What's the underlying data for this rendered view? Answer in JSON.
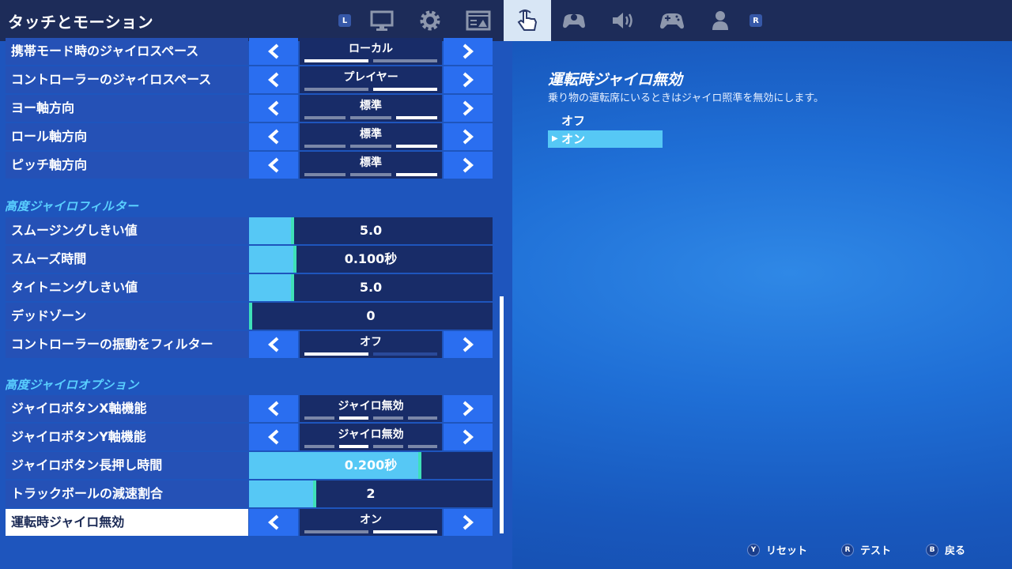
{
  "header": {
    "title": "タッチとモーション",
    "shoulder_left": "L",
    "shoulder_right": "R",
    "tabs": [
      {
        "icon": "monitor-icon"
      },
      {
        "icon": "gear-icon"
      },
      {
        "icon": "display-settings-icon"
      },
      {
        "icon": "touch-hand-icon",
        "active": true
      },
      {
        "icon": "gamepad-settings-icon"
      },
      {
        "icon": "speaker-icon"
      },
      {
        "icon": "controller-icon"
      },
      {
        "icon": "account-icon"
      }
    ]
  },
  "settings": {
    "handheld_gyro_space": {
      "label": "携帯モード時のジャイロスペース",
      "value": "ローカル"
    },
    "controller_gyro_space": {
      "label": "コントローラーのジャイロスペース",
      "value": "プレイヤー"
    },
    "yaw_direction": {
      "label": "ヨー軸方向",
      "value": "標準"
    },
    "roll_direction": {
      "label": "ロール軸方向",
      "value": "標準"
    },
    "pitch_direction": {
      "label": "ピッチ軸方向",
      "value": "標準"
    },
    "section_filter": "高度ジャイロフィルター",
    "smoothing_threshold": {
      "label": "スムージングしきい値",
      "value": "5.0",
      "level": 0.09
    },
    "smooth_time": {
      "label": "スムーズ時間",
      "value": "0.100秒",
      "level": 0.1
    },
    "tightening_threshold": {
      "label": "タイトニングしきい値",
      "value": "5.0",
      "level": 0.09
    },
    "deadzone": {
      "label": "デッドゾーン",
      "value": "0",
      "level": 0
    },
    "vibration_filter": {
      "label": "コントローラーの振動をフィルター",
      "value": "オフ"
    },
    "section_options": "高度ジャイロオプション",
    "gyro_button_x": {
      "label": "ジャイロボタンX軸機能",
      "value": "ジャイロ無効"
    },
    "gyro_button_y": {
      "label": "ジャイロボタンY軸機能",
      "value": "ジャイロ無効"
    },
    "gyro_hold_time": {
      "label": "ジャイロボタン長押し時間",
      "value": "0.200秒",
      "level": 0.67
    },
    "trackball_decel": {
      "label": "トラックボールの減速割合",
      "value": "2",
      "level": 0.19
    },
    "disable_gyro_driving": {
      "label": "運転時ジャイロ無効",
      "value": "オン"
    }
  },
  "detail": {
    "title": "運転時ジャイロ無効",
    "description": "乗り物の運転席にいるときはジャイロ照準を無効にします。",
    "options": [
      "オフ",
      "オン"
    ],
    "selected_index": 1
  },
  "footer": {
    "reset": {
      "button": "Y",
      "label": "リセット"
    },
    "test": {
      "button": "R",
      "label": "テスト"
    },
    "back": {
      "button": "B",
      "label": "戻る"
    }
  },
  "colors": {
    "background": "#1e63d0",
    "topbar": "#1d2c59",
    "accent_cyan": "#56c8f5",
    "arrow_button": "#2a6ef0",
    "value_box": "#182c68"
  }
}
